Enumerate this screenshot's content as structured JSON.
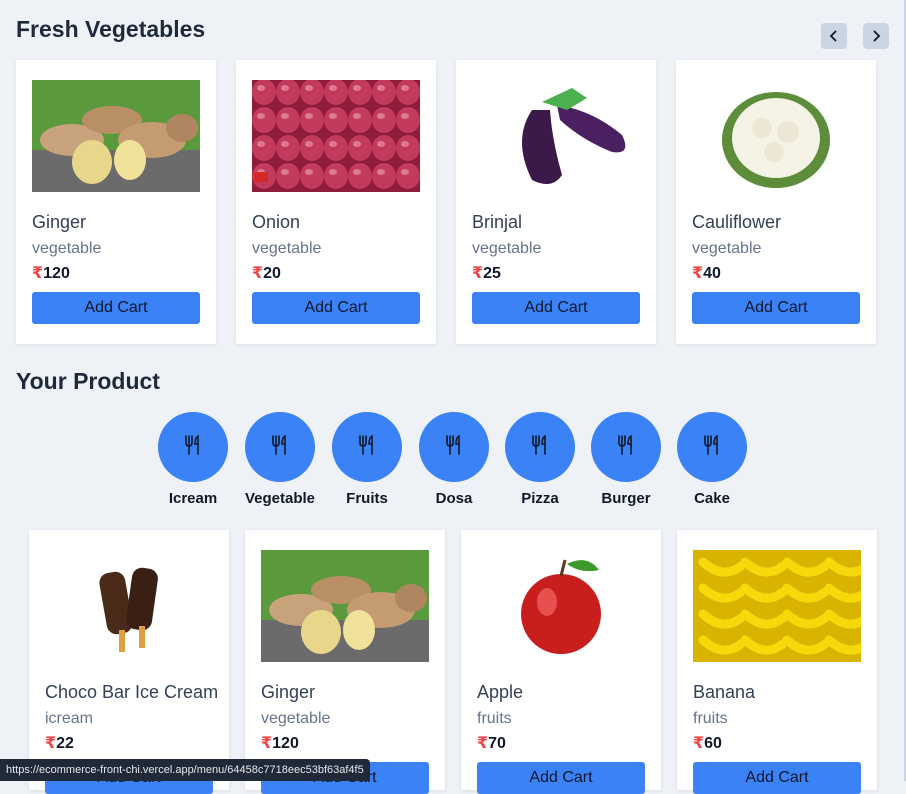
{
  "fresh_vegetables": {
    "title": "Fresh Vegetables",
    "items": [
      {
        "name": "Ginger",
        "category": "vegetable",
        "currency": "₹",
        "price": "120",
        "button": "Add Cart",
        "image": "ginger"
      },
      {
        "name": "Onion",
        "category": "vegetable",
        "currency": "₹",
        "price": "20",
        "button": "Add Cart",
        "image": "onion"
      },
      {
        "name": "Brinjal",
        "category": "vegetable",
        "currency": "₹",
        "price": "25",
        "button": "Add Cart",
        "image": "brinjal"
      },
      {
        "name": "Cauliflower",
        "category": "vegetable",
        "currency": "₹",
        "price": "40",
        "button": "Add Cart",
        "image": "cauliflower"
      }
    ]
  },
  "your_product": {
    "title": "Your Product",
    "categories": [
      {
        "label": "Icream",
        "icon": "cutlery-icon"
      },
      {
        "label": "Vegetable",
        "icon": "cutlery-icon"
      },
      {
        "label": "Fruits",
        "icon": "cutlery-icon"
      },
      {
        "label": "Dosa",
        "icon": "cutlery-icon"
      },
      {
        "label": "Pizza",
        "icon": "cutlery-icon"
      },
      {
        "label": "Burger",
        "icon": "cutlery-icon"
      },
      {
        "label": "Cake",
        "icon": "cutlery-icon"
      }
    ],
    "items": [
      {
        "name": "Choco Bar Ice Cream",
        "category": "icream",
        "currency": "₹",
        "price": "22",
        "button": "Add Cart",
        "image": "chocobar"
      },
      {
        "name": "Ginger",
        "category": "vegetable",
        "currency": "₹",
        "price": "120",
        "button": "Add Cart",
        "image": "ginger"
      },
      {
        "name": "Apple",
        "category": "fruits",
        "currency": "₹",
        "price": "70",
        "button": "Add Cart",
        "image": "apple"
      },
      {
        "name": "Banana",
        "category": "fruits",
        "currency": "₹",
        "price": "60",
        "button": "Add Cart",
        "image": "banana"
      }
    ]
  },
  "nav": {
    "prev_icon": "chevron-left-icon",
    "next_icon": "chevron-right-icon"
  },
  "status_bar": {
    "url": "https://ecommerce-front-chi.vercel.app/menu/64458c7718eec53bf63af4f5"
  },
  "colors": {
    "accent": "#3b82f6",
    "background": "#eef2f7",
    "rupee": "#ef4444"
  }
}
